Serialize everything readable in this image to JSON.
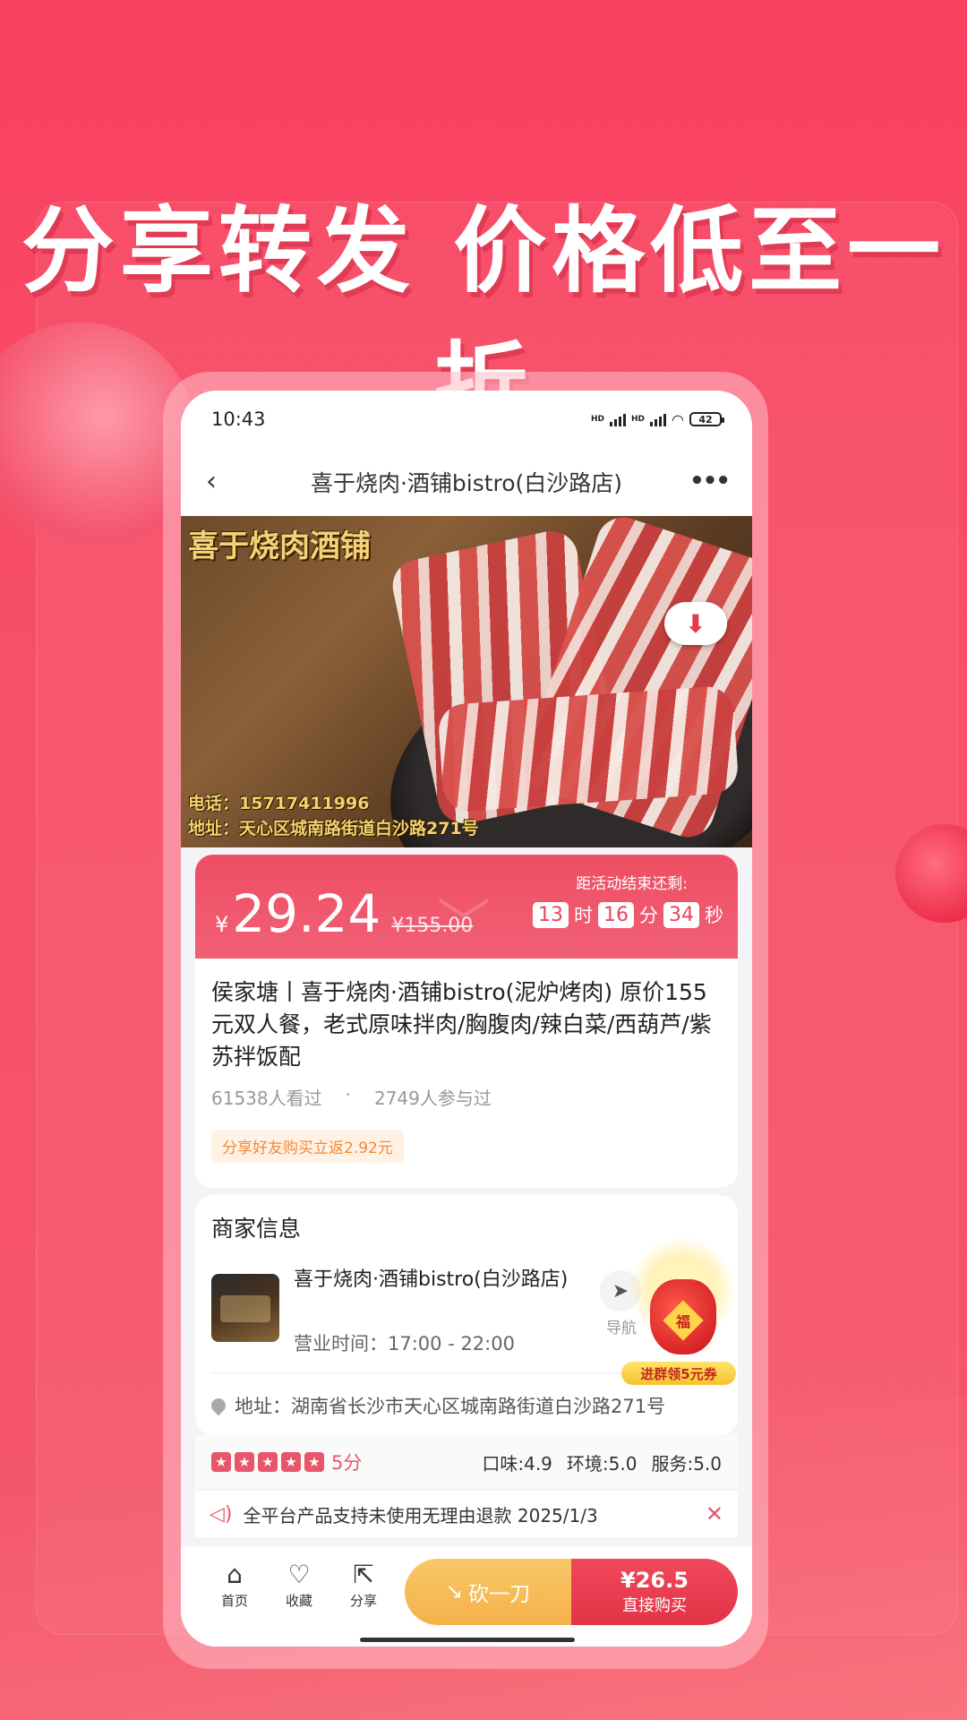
{
  "banner": {
    "headline": "分享转发 价格低至一折"
  },
  "status_bar": {
    "time": "10:43",
    "hd1": "HD",
    "hd2": "HD",
    "battery": "42"
  },
  "nav": {
    "back": "‹",
    "title": "喜于烧肉·酒铺bistro(白沙路店)",
    "more": "•••"
  },
  "hero": {
    "title": "喜于烧肉酒铺",
    "phone_caption": "电话：15717411996",
    "address_caption": "地址：天心区城南路街道白沙路271号"
  },
  "price": {
    "currency": "¥",
    "value": "29.24",
    "original": "¥155.00",
    "countdown_label": "距活动结束还剩:",
    "hours": "13",
    "hours_unit": "时",
    "minutes": "16",
    "minutes_unit": "分",
    "seconds": "34",
    "seconds_unit": "秒"
  },
  "deal": {
    "title": "侯家塘丨喜于烧肉·酒铺bistro(泥炉烤肉) 原价155元双人餐，老式原味拌肉/胸腹肉/辣白菜/西葫芦/紫苏拌饭配",
    "views": "61538人看过",
    "separator": "·",
    "participants": "2749人参与过",
    "promo": "分享好友购买立返2.92元"
  },
  "merchant": {
    "heading": "商家信息",
    "name": "喜于烧肉·酒铺bistro(白沙路店)",
    "hours": "营业时间：17:00 - 22:00",
    "nav_label": "导航",
    "address": "地址：湖南省长沙市天心区城南路街道白沙路271号"
  },
  "ratings": {
    "stars": 5,
    "score": "5分",
    "taste": "口味:4.9",
    "environment": "环境:5.0",
    "service": "服务:5.0"
  },
  "notice": {
    "text": "全平台产品支持未使用无理由退款 2025/1/3",
    "close": "✕"
  },
  "bottom": {
    "home": "首页",
    "favorite": "收藏",
    "share": "分享",
    "bargain": "砍一刀",
    "buy_price": "¥26.5",
    "buy_label": "直接购买"
  },
  "floating": {
    "fu_char": "福",
    "label": "进群领5元券"
  },
  "colors": {
    "brand_red": "#e8465b",
    "gold": "#f5b14a",
    "promo_orange": "#f08a3a"
  },
  "icons": [
    "back-icon",
    "more-icon",
    "download-cloud-icon",
    "navigation-arrow-icon",
    "location-pin-icon",
    "star-icon",
    "speaker-icon",
    "close-icon",
    "home-icon",
    "heart-icon",
    "share-icon",
    "knife-arrow-icon"
  ]
}
